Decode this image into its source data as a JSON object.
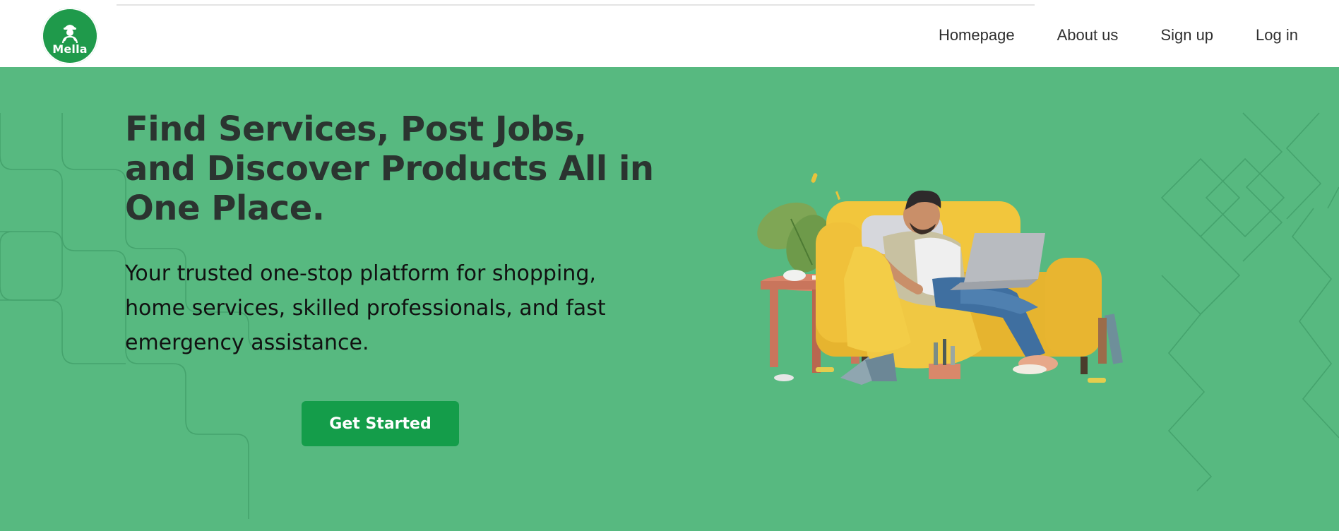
{
  "header": {
    "logo_text": "Mella",
    "nav": [
      {
        "label": "Homepage"
      },
      {
        "label": "About us"
      },
      {
        "label": "Sign up"
      },
      {
        "label": "Log in"
      }
    ]
  },
  "hero": {
    "headline_lines": [
      "Find Services, Post Jobs,",
      "and Discover Products All in",
      "One Place."
    ],
    "subtext_lines": [
      "Your trusted one-stop platform for shopping,",
      "home services, skilled professionals, and fast",
      "emergency assistance."
    ],
    "cta_label": "Get Started",
    "illustration": "man-relaxing-on-sofa-with-laptop"
  },
  "colors": {
    "brand_green": "#1f9a4b",
    "hero_background": "#57b980",
    "cta_background": "#149d4a",
    "heading_text": "#2b3430"
  }
}
